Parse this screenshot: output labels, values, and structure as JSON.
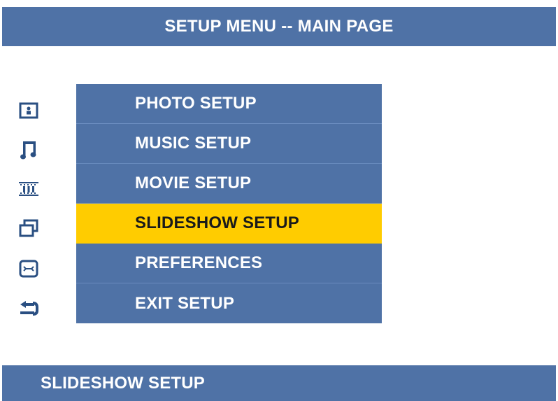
{
  "header": {
    "title": "SETUP MENU -- MAIN PAGE"
  },
  "menu": {
    "selected_index": 3,
    "items": [
      {
        "label": "PHOTO SETUP",
        "icon": "photo-icon"
      },
      {
        "label": "MUSIC SETUP",
        "icon": "music-note-icon"
      },
      {
        "label": "MOVIE SETUP",
        "icon": "film-strip-icon"
      },
      {
        "label": "SLIDESHOW SETUP",
        "icon": "slideshow-icon"
      },
      {
        "label": "PREFERENCES",
        "icon": "preferences-icon"
      },
      {
        "label": "EXIT SETUP",
        "icon": "exit-arrow-icon"
      }
    ]
  },
  "status": {
    "text": "SLIDESHOW SETUP"
  },
  "colors": {
    "bar_blue": "#4f72a6",
    "highlight_yellow": "#ffcc00",
    "icon_blue": "#2a4f82"
  }
}
